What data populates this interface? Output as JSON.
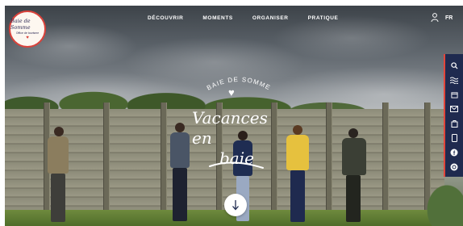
{
  "logo": {
    "line1": "Baie de Somme",
    "line2": "Office de tourisme"
  },
  "nav": {
    "items": [
      "DÉCOUVRIR",
      "MOMENTS",
      "ORGANISER",
      "PRATIQUE"
    ]
  },
  "header": {
    "language": "FR"
  },
  "hero": {
    "kicker": "BAIE DE SOMME",
    "title_line1": "Vacances en",
    "title_line2": "baie"
  },
  "sidebar": {
    "icons": [
      "search-icon",
      "waves-icon",
      "calendar-icon",
      "mail-icon",
      "bag-icon",
      "phone-icon",
      "facebook-icon",
      "instagram-icon"
    ]
  },
  "colors": {
    "accent": "#e2463b",
    "navy": "#1f2a4f"
  }
}
